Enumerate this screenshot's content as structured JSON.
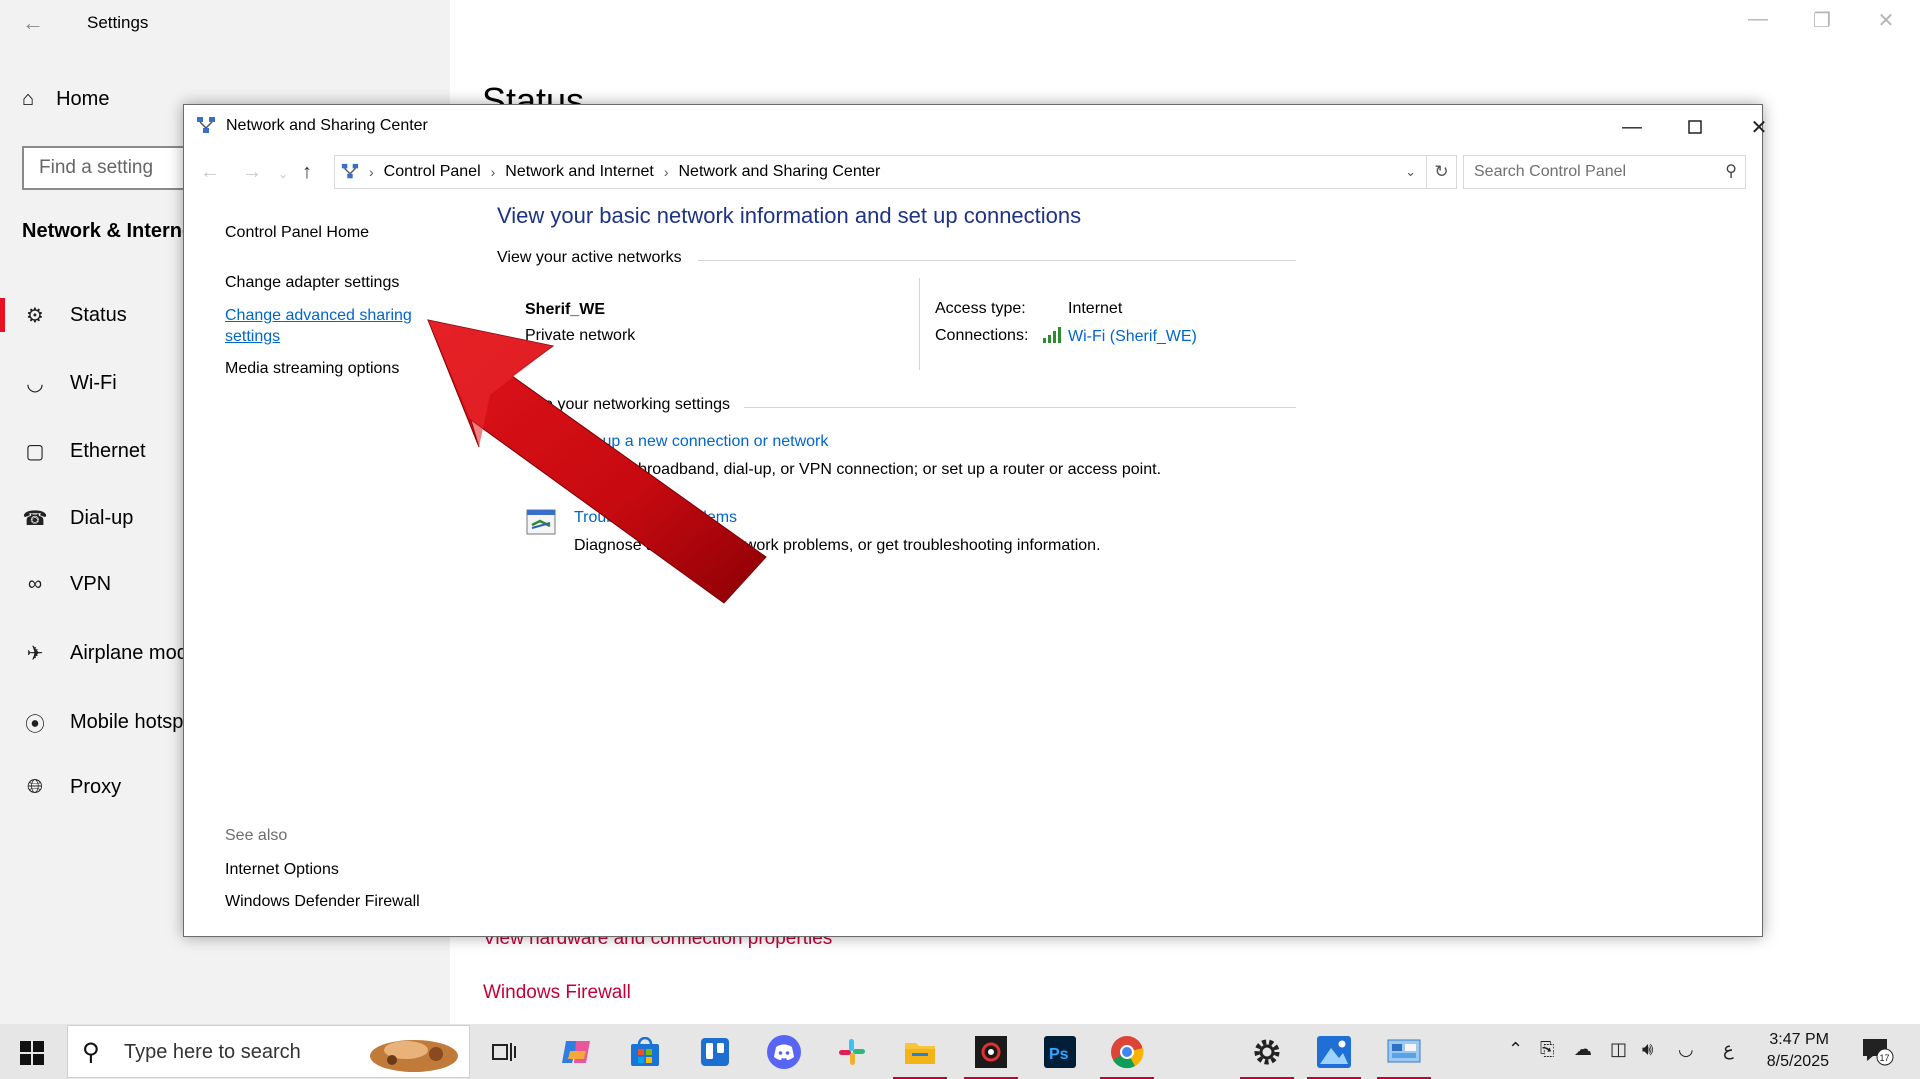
{
  "settings": {
    "title": "Settings",
    "home_label": "Home",
    "search_placeholder": "Find a setting",
    "section_title": "Network & Internet",
    "nav_items": [
      {
        "label": "Status",
        "icon": "globe-icon"
      },
      {
        "label": "Wi-Fi",
        "icon": "wifi-icon"
      },
      {
        "label": "Ethernet",
        "icon": "ethernet-icon"
      },
      {
        "label": "Dial-up",
        "icon": "dialup-icon"
      },
      {
        "label": "VPN",
        "icon": "vpn-icon"
      },
      {
        "label": "Airplane mode",
        "icon": "airplane-icon"
      },
      {
        "label": "Mobile hotspot",
        "icon": "hotspot-icon"
      },
      {
        "label": "Proxy",
        "icon": "globe-icon"
      }
    ],
    "page_heading": "Status",
    "hardware_link": "View hardware and connection properties",
    "firewall_link": "Windows Firewall",
    "accent_color": "#c4003a"
  },
  "nsc": {
    "title": "Network and Sharing Center",
    "breadcrumb": [
      "Control Panel",
      "Network and Internet",
      "Network and Sharing Center"
    ],
    "search_placeholder": "Search Control Panel",
    "left_links": {
      "home": "Control Panel Home",
      "adapter": "Change adapter settings",
      "advanced_sharing": "Change advanced sharing settings",
      "media_streaming": "Media streaming options"
    },
    "see_also": {
      "label": "See also",
      "items": [
        "Internet Options",
        "Windows Defender Firewall"
      ]
    },
    "heading": "View your basic network information and set up connections",
    "active_networks_label": "View your active networks",
    "network": {
      "name": "Sherif_WE",
      "category": "Private network",
      "access_type_label": "Access type:",
      "access_type_value": "Internet",
      "connections_label": "Connections:",
      "connections_value": "Wi-Fi (Sherif_WE)"
    },
    "change_settings_label": "Change your networking settings",
    "tasks": [
      {
        "title": "Set up a new connection or network",
        "desc": "Set up a broadband, dial-up, or VPN connection; or set up a router or access point.",
        "icon": "new-connection-icon"
      },
      {
        "title": "Troubleshoot problems",
        "desc": "Diagnose and repair network problems, or get troubleshooting information.",
        "icon": "troubleshoot-icon"
      }
    ],
    "heading_color": "#1e3287",
    "link_color": "#0066cc"
  },
  "annotation": {
    "type": "arrow",
    "color": "#d10a0a",
    "points_to": "advanced-sharing-link"
  },
  "taskbar": {
    "search_placeholder": "Type here to search",
    "apps": [
      "task-view-icon",
      "copilot-icon",
      "store-icon",
      "trello-icon",
      "discord-icon",
      "slack-icon",
      "file-explorer-icon",
      "obs-icon",
      "photoshop-icon",
      "chrome-icon",
      "settings-icon",
      "photos-icon",
      "control-panel-icon"
    ],
    "time": "3:47 PM",
    "date": "8/5/2025",
    "language": "ع",
    "notification_count": "17"
  }
}
